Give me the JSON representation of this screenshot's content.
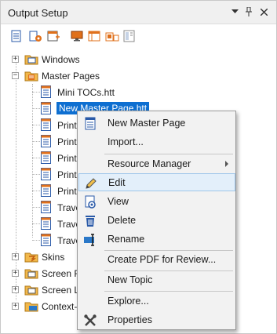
{
  "panel": {
    "title": "Output Setup",
    "controls": [
      "pin-dropdown-icon",
      "pin-icon",
      "close-icon"
    ]
  },
  "toolbar": {
    "buttons": [
      "new-target-icon",
      "new-skin-icon",
      "new-page-layout-icon",
      "monitor-icon",
      "browser-settings-icon",
      "multi-device-icon",
      "stylesheet-icon"
    ]
  },
  "tree": {
    "nodes": [
      {
        "label": "Windows",
        "kind": "folder-windows",
        "expander": "+",
        "level": 0
      },
      {
        "label": "Master Pages",
        "kind": "folder-masterpages",
        "expander": "−",
        "level": 0
      },
      {
        "label": "Mini TOCs.htt",
        "kind": "file",
        "level": 1
      },
      {
        "label": "New Master Page.htt",
        "kind": "file",
        "level": 1,
        "selected": true
      },
      {
        "label": "Print",
        "kind": "file",
        "level": 1
      },
      {
        "label": "Print",
        "kind": "file",
        "level": 1
      },
      {
        "label": "Print",
        "kind": "file",
        "level": 1
      },
      {
        "label": "Print",
        "kind": "file",
        "level": 1
      },
      {
        "label": "Print",
        "kind": "file",
        "level": 1
      },
      {
        "label": "Trave",
        "kind": "file",
        "level": 1
      },
      {
        "label": "Trave",
        "kind": "file",
        "level": 1
      },
      {
        "label": "Trave",
        "kind": "file",
        "level": 1
      },
      {
        "label": "Skins",
        "kind": "folder-skins",
        "expander": "+",
        "level": 0
      },
      {
        "label": "Screen F",
        "kind": "folder-screen",
        "expander": "+",
        "level": 0
      },
      {
        "label": "Screen L",
        "kind": "folder-screen",
        "expander": "+",
        "level": 0
      },
      {
        "label": "Context-S",
        "kind": "folder-context",
        "expander": "+",
        "level": 0
      }
    ]
  },
  "context_menu": {
    "items": [
      {
        "label": "New Master Page",
        "icon": "new-master-page-icon"
      },
      {
        "label": "Import...",
        "icon": ""
      },
      {
        "label": "Resource Manager",
        "icon": "",
        "submenu": true
      },
      {
        "label": "Edit",
        "icon": "pencil-icon",
        "hover": true
      },
      {
        "label": "View",
        "icon": "view-icon"
      },
      {
        "label": "Delete",
        "icon": "trash-icon"
      },
      {
        "label": "Rename",
        "icon": "rename-icon"
      },
      {
        "label": "Create PDF for Review...",
        "icon": ""
      },
      {
        "label": "New Topic",
        "icon": ""
      },
      {
        "label": "Explore...",
        "icon": ""
      },
      {
        "label": "Properties",
        "icon": "properties-icon"
      }
    ]
  },
  "colors": {
    "selection": "#0e6fd1",
    "menu_hover": "#e3effa",
    "folder": "#f2b84b",
    "accent_orange": "#e0701b"
  }
}
